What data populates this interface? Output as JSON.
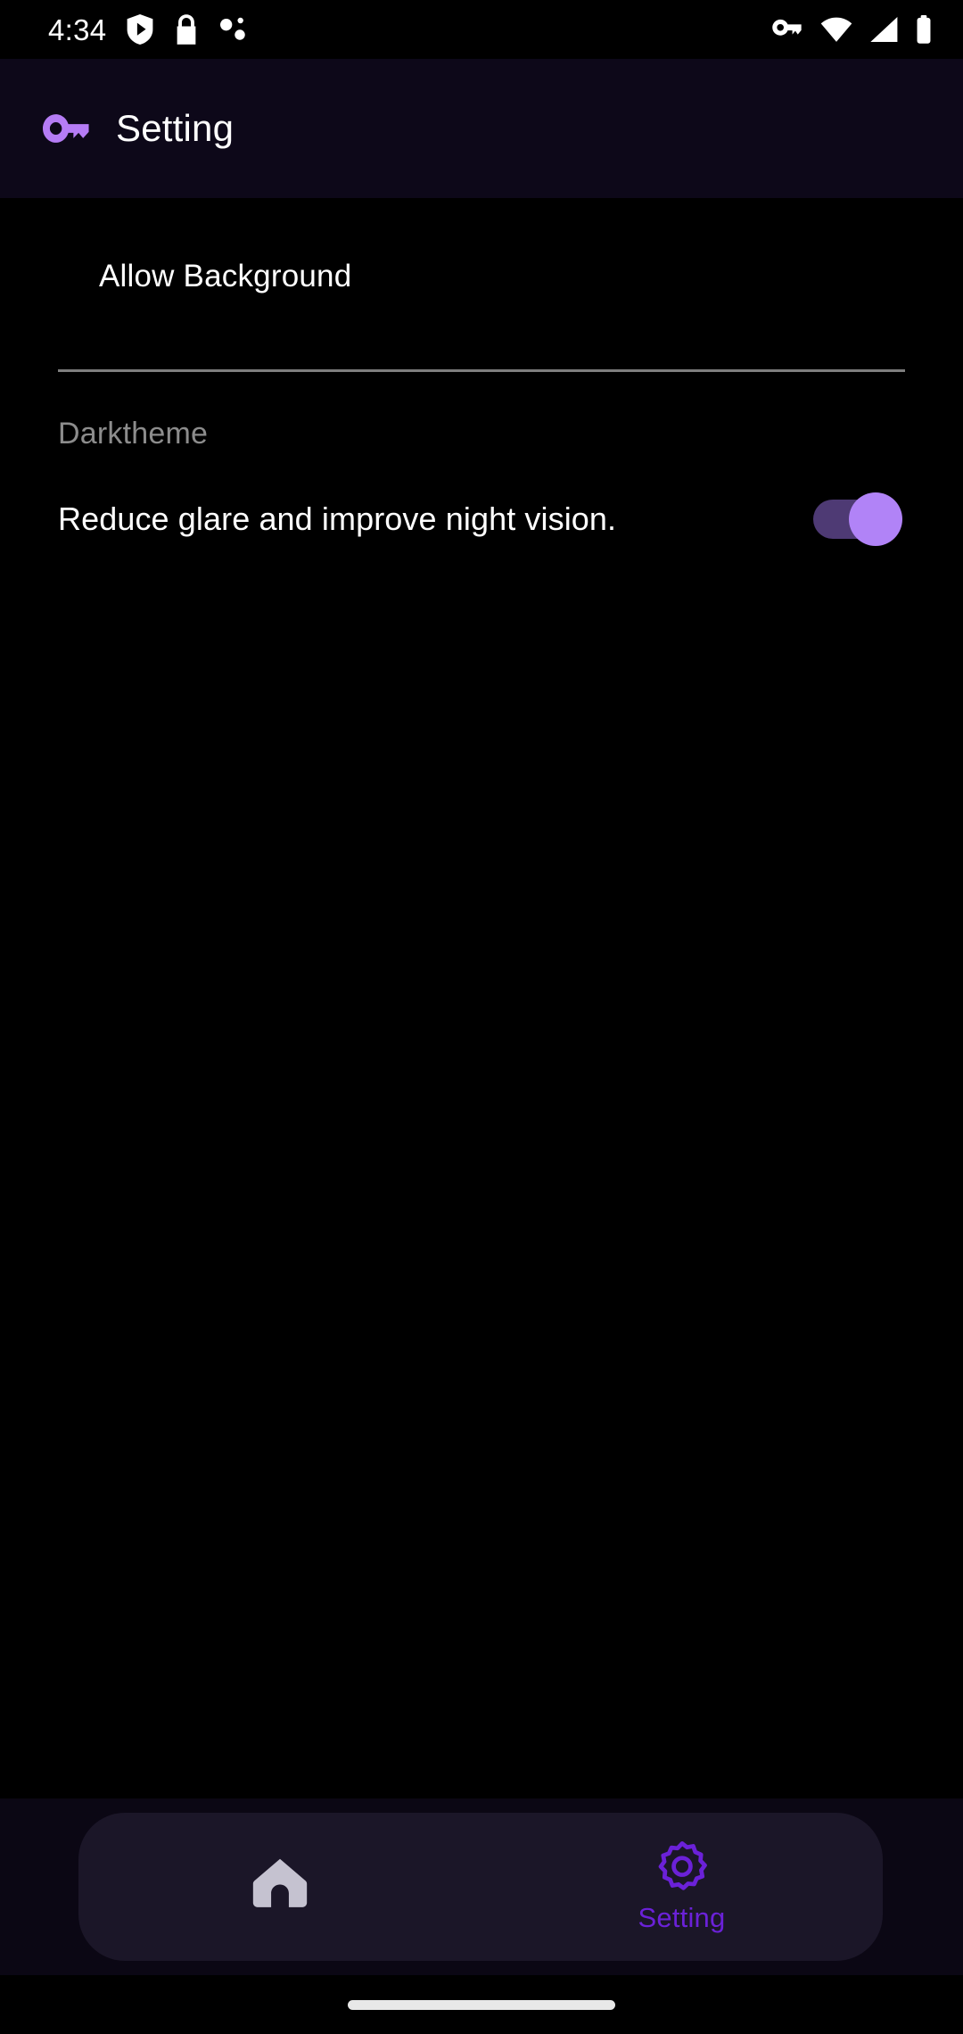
{
  "status_bar": {
    "clock": "4:34",
    "left_icons": [
      "play-protect-shield-icon",
      "lock-icon",
      "debug-dots-icon"
    ],
    "right_icons": [
      "vpn-key-icon",
      "wifi-icon",
      "cellular-signal-icon",
      "battery-icon"
    ]
  },
  "header": {
    "icon": "key-icon",
    "title": "Setting",
    "background_color": "#0D0819",
    "icon_color": "#B57CF5"
  },
  "main": {
    "allow_background": {
      "label": "Allow Background",
      "divider_color": "#7E7E7E"
    },
    "dark_theme": {
      "section_label": "Darktheme",
      "section_label_color": "#8C8C8C",
      "description": "Reduce glare and improve night vision.",
      "toggle": {
        "name": "dark-theme-toggle",
        "state": "on",
        "track_color": "#4E3A74",
        "thumb_color": "#B183F7"
      }
    }
  },
  "bottom_nav": {
    "background_color": "#1B1628",
    "active_color": "#6B21D8",
    "inactive_color": "#C5C2D0",
    "items": [
      {
        "icon": "home-icon",
        "label": "",
        "active": false
      },
      {
        "icon": "gear-icon",
        "label": "Setting",
        "active": true
      }
    ]
  },
  "gesture_bar": {
    "color": "#E8E8E8"
  }
}
